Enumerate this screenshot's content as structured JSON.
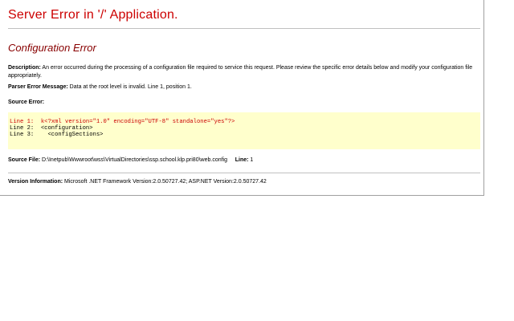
{
  "page": {
    "title": "Server Error in '/' Application.",
    "subtitle": "Configuration Error"
  },
  "description": {
    "label": "Description:",
    "text": "An error occurred during the processing of a configuration file required to service this request. Please review the specific error details below and modify your configuration file appropriately."
  },
  "parser": {
    "label": "Parser Error Message:",
    "text": "Data at the root level is invalid. Line 1, position 1."
  },
  "source_error": {
    "label": "Source Error:",
    "lines": [
      {
        "num": "Line 1:",
        "code": "k<?xml version=\"1.0\" encoding=\"UTF-8\" standalone=\"yes\"?>"
      },
      {
        "num": "Line 2:",
        "code": "<configuration>"
      },
      {
        "num": "Line 3:",
        "code": "  <configSections>"
      }
    ]
  },
  "source_file": {
    "label": "Source File:",
    "path": "D:\\Inetpub\\Wwwroot\\wss\\VirtualDirectories\\ssp.school.klp.pri80\\web.config",
    "line_label": "Line:",
    "line_value": "1"
  },
  "version": {
    "label": "Version Information:",
    "text": "Microsoft .NET Framework Version:2.0.50727.42; ASP.NET Version:2.0.50727.42"
  },
  "colors": {
    "title": "#cc0000",
    "subtitle": "#880000",
    "code_bg": "#ffffcc"
  }
}
